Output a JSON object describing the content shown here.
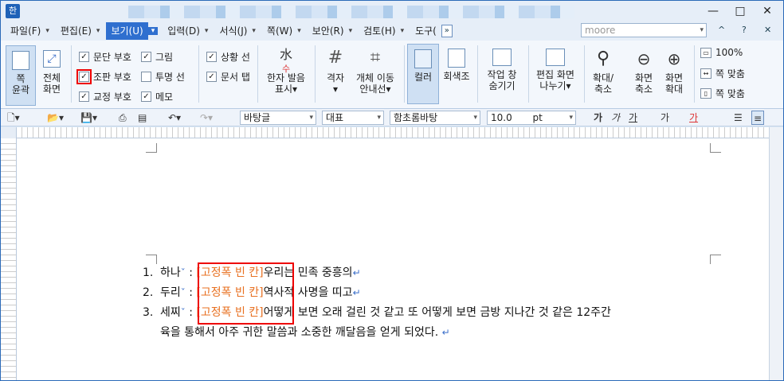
{
  "app": {
    "icon_label": "한"
  },
  "window_controls": {
    "minimize": "—",
    "maximize": "□",
    "close": "✕"
  },
  "menu": {
    "items": [
      "파일(F)",
      "편집(E)",
      "보기(U)",
      "입력(D)",
      "서식(J)",
      "쪽(W)",
      "보안(R)",
      "검토(H)",
      "도구("
    ],
    "active": "보기(U)",
    "overflow": "»",
    "search_value": "moore",
    "right_icons": [
      "^",
      "?",
      "✕"
    ]
  },
  "ribbon": {
    "page_outline": "쪽\n윤곽",
    "full_screen": "전체\n화면",
    "checks": [
      {
        "label": "문단 부호",
        "checked": true
      },
      {
        "label": "조판 부호",
        "checked": true
      },
      {
        "label": "교정 부호",
        "checked": true
      },
      {
        "label": "그림",
        "checked": true
      },
      {
        "label": "투명 선",
        "checked": false
      },
      {
        "label": "메모",
        "checked": true
      },
      {
        "label": "상황 선",
        "checked": true
      },
      {
        "label": "문서 탭",
        "checked": true
      }
    ],
    "hanja": "한자 발음\n표시▾",
    "grid": "격자\n▾",
    "object_move": "개체 이동\n안내선▾",
    "color": "컬러",
    "grayscale": "회색조",
    "task_window": "작업 창\n숨기기",
    "split": "편집 화면\n나누기▾",
    "zoom": "확대/\n축소",
    "zoom_out": "화면\n축소",
    "zoom_in": "화면\n확대",
    "zoom_pct": "100%",
    "fit_width": "쪽 맞춤",
    "fit_page": "쪽 맞춤"
  },
  "format_bar": {
    "style": "바탕글",
    "lang": "대표",
    "font": "함초롬바탕",
    "size": "10.0",
    "unit": "pt",
    "styles": [
      "가",
      "가",
      "가",
      "가",
      "가"
    ]
  },
  "document": {
    "items": [
      {
        "num": "1.",
        "lead": "하나",
        "tag": "[고정폭 빈 칸]",
        "text": "우리는 민족 중흥의"
      },
      {
        "num": "2.",
        "lead": "두리",
        "tag": "[고정폭 빈 칸]",
        "text": "역사적 사명을 띠고"
      },
      {
        "num": "3.",
        "lead": "세찌",
        "tag": "[고정폭 빈 칸]",
        "text": "어떻게 보면 오래 걸린 것 같고 또 어떻게 보면 금방 지나간 것 같은 12주간"
      }
    ],
    "continuation": "육을 통해서 아주 귀한 말씀과 소중한 깨달음을 얻게 되었다."
  }
}
